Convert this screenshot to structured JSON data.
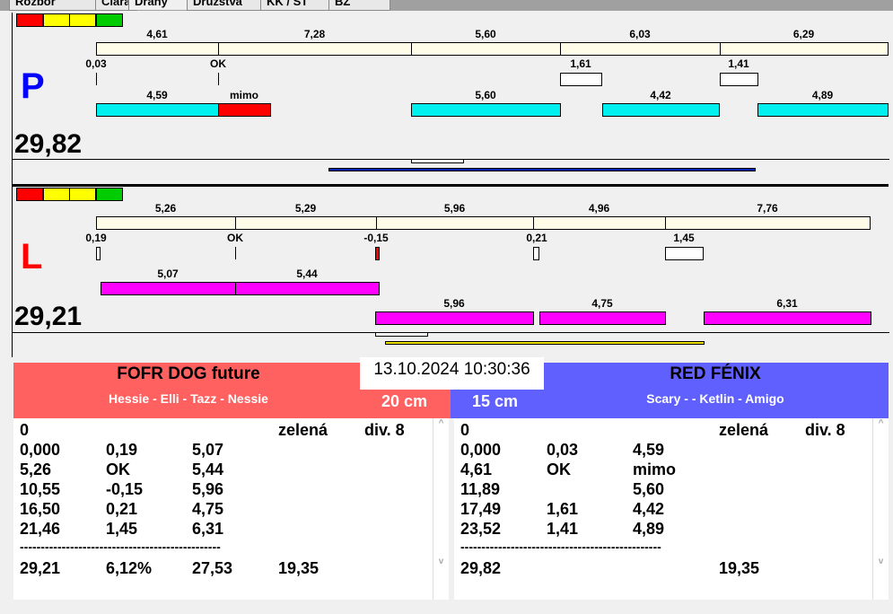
{
  "tabs": [
    "Rozbor",
    "Čiara",
    "Dráhy",
    "Družstvá",
    "KK / ST",
    "BZ"
  ],
  "colors": {
    "red": "#ff0000",
    "yellow": "#ffff00",
    "green": "#00cc00",
    "cream": "#fffde8",
    "cyan": "#00f0f0",
    "magenta": "#ff00ff",
    "left_team": "#ff6060",
    "right_team": "#6060ff",
    "p_line": "#0020b0",
    "l_line": "#f0e000"
  },
  "lane_p": {
    "side": "P",
    "total": "29,82",
    "top": [
      "4,61",
      "7,28",
      "5,60",
      "6,03",
      "6,29"
    ],
    "mid": [
      "0,03",
      "OK",
      "1,61",
      "1,41"
    ],
    "bottom": [
      "4,59",
      "mimo",
      "5,60",
      "4,42",
      "4,89"
    ]
  },
  "lane_l": {
    "side": "L",
    "total": "29,21",
    "top": [
      "5,26",
      "5,29",
      "5,96",
      "4,96",
      "7,76"
    ],
    "mid": [
      "0,19",
      "OK",
      "-0,15",
      "0,21",
      "1,45"
    ],
    "bottom": [
      "5,07",
      "5,44",
      "5,96",
      "4,75",
      "6,31"
    ]
  },
  "datetime": "13.10.2024 10:30:36",
  "left_team": {
    "name": "FOFR DOG future",
    "dogs": "Hessie - Elli - Tazz - Nessie",
    "height": "20 cm",
    "rows": [
      [
        "0",
        "",
        "",
        "zelená",
        "div. 8"
      ],
      [
        "0,000",
        "0,19",
        "5,07",
        "",
        ""
      ],
      [
        "5,26",
        "OK",
        "5,44",
        "",
        ""
      ],
      [
        "10,55",
        "-0,15",
        "5,96",
        "",
        ""
      ],
      [
        "16,50",
        "0,21",
        "4,75",
        "",
        ""
      ],
      [
        "21,46",
        "1,45",
        "6,31",
        "",
        ""
      ],
      [
        "------------------------------------------------",
        "",
        "",
        "",
        ""
      ],
      [
        "29,21",
        "6,12%",
        "27,53",
        "19,35",
        ""
      ]
    ]
  },
  "right_team": {
    "name": "RED FÉNIX",
    "dogs": "Scary -  - Ketlin - Amigo",
    "height": "15 cm",
    "rows": [
      [
        "0",
        "",
        "",
        "zelená",
        "div. 8"
      ],
      [
        "0,000",
        "0,03",
        "4,59",
        "",
        ""
      ],
      [
        "4,61",
        "OK",
        "mimo",
        "",
        ""
      ],
      [
        "11,89",
        "",
        "5,60",
        "",
        ""
      ],
      [
        "17,49",
        "1,61",
        "4,42",
        "",
        ""
      ],
      [
        "23,52",
        "1,41",
        "4,89",
        "",
        ""
      ],
      [
        "------------------------------------------------",
        "",
        "",
        "",
        ""
      ],
      [
        "29,82",
        "",
        "",
        "19,35",
        ""
      ]
    ]
  }
}
